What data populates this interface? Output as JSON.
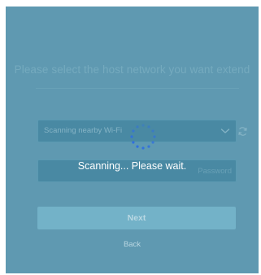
{
  "instruction": "Please select the host network you want extend",
  "network_select": {
    "value": "Scanning nearby Wi-Fi",
    "icon": "chevron-down-icon"
  },
  "refresh": {
    "icon": "refresh-icon"
  },
  "password_field": {
    "placeholder": "Password"
  },
  "scanning": {
    "message": "Scanning... Please wait.",
    "icon": "spinner-icon"
  },
  "buttons": {
    "next_label": "Next",
    "back_label": "Back"
  },
  "colors": {
    "background": "#8cb5c6",
    "spinner": "#2f6fe0",
    "button": "#73b2c8",
    "text_light": "#ffffff"
  }
}
